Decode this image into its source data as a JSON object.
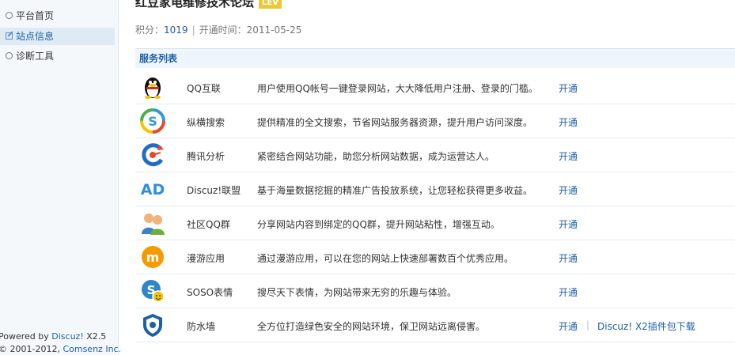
{
  "sidebar": {
    "items": [
      {
        "label": "平台首页",
        "icon": "circle-icon",
        "active": false
      },
      {
        "label": "站点信息",
        "icon": "edit-icon",
        "active": true
      },
      {
        "label": "诊断工具",
        "icon": "circle-icon",
        "active": false
      }
    ],
    "footer": {
      "line1_prefix": "Powered by ",
      "line1_brand": "Discuz!",
      "line1_version": " X2.5",
      "line2_prefix": "© 2001-2012, ",
      "line2_brand": "Comsenz Inc."
    }
  },
  "site": {
    "title": "红豆家电维修技术论坛",
    "badge": "LEV",
    "score_label": "积分：",
    "score_value": "1019",
    "separator": "|",
    "open_label": "开通时间：",
    "open_date": "2011-05-25"
  },
  "services": {
    "header": "服务列表",
    "rows": [
      {
        "name": "QQ互联",
        "desc": "用户使用QQ帐号一键登录网站，大大降低用户注册、登录的门槛。",
        "action": "开通",
        "icon": "qq-penguin-icon",
        "color": "#f4c400"
      },
      {
        "name": "纵横搜索",
        "desc": "提供精准的全文搜索，节省网站服务器资源，提升用户访问深度。",
        "action": "开通",
        "icon": "soso-search-icon",
        "color": "#2f9ad8"
      },
      {
        "name": "腾讯分析",
        "desc": "紧密结合网站功能，助您分析网站数据，成为运营达人。",
        "action": "开通",
        "icon": "tencent-analytics-icon",
        "color": "#1e6fc4"
      },
      {
        "name": "Discuz!联盟",
        "desc": "基于海量数据挖掘的精准广告投放系统，让您轻松获得更多收益。",
        "action": "开通",
        "icon": "ad-union-icon",
        "color": "#2f8ee0"
      },
      {
        "name": "社区QQ群",
        "desc": "分享网站内容到绑定的QQ群，提升网站粘性，增强互动。",
        "action": "开通",
        "icon": "qq-group-icon",
        "color": "#6fae3a"
      },
      {
        "name": "漫游应用",
        "desc": "通过漫游应用，可以在您的网站上快速部署数百个优秀应用。",
        "action": "开通",
        "icon": "manyou-app-icon",
        "color": "#f59a00"
      },
      {
        "name": "SOSO表情",
        "desc": "搜尽天下表情，为网站带来无穷的乐趣与体验。",
        "action": "开通",
        "icon": "soso-emoji-icon",
        "color": "#2f86c8"
      },
      {
        "name": "防水墙",
        "desc": "全方位打造绿色安全的网站环境，保卫网站远离侵害。",
        "action": "开通",
        "extra": "Discuz! X2插件包下载",
        "icon": "security-shield-icon",
        "color": "#1e5fa8"
      }
    ]
  }
}
